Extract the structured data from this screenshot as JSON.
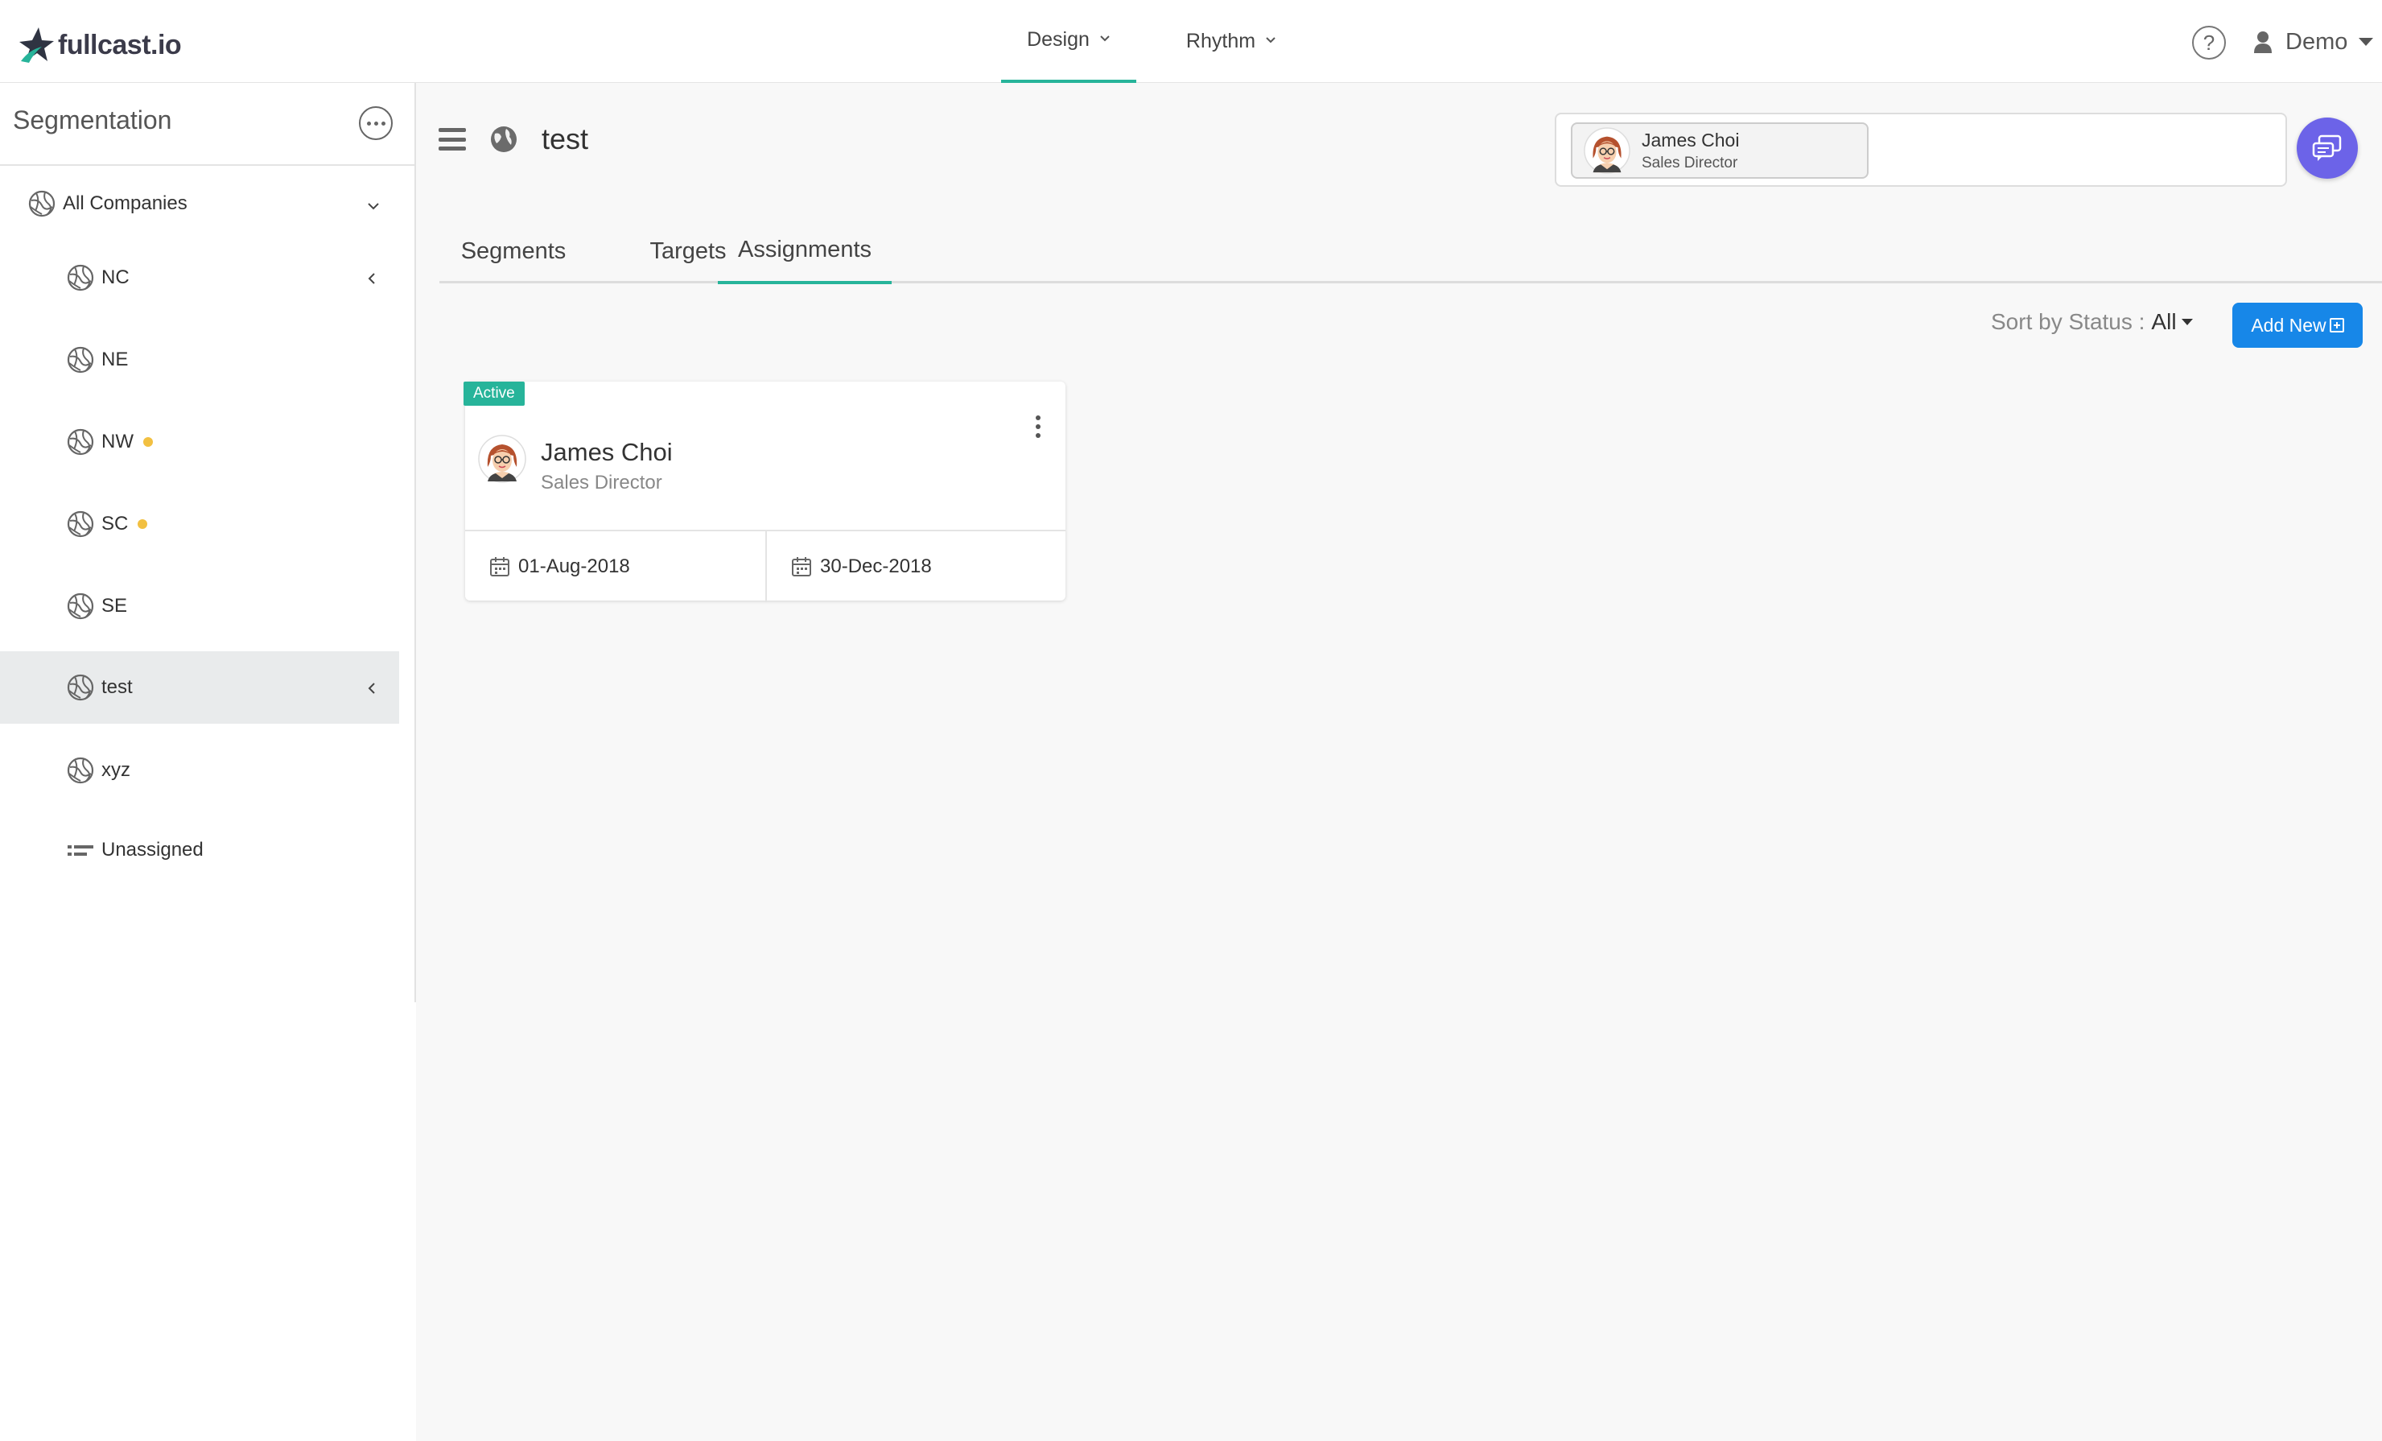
{
  "app": {
    "logo_text": "fullcast.io"
  },
  "topnav": {
    "items": [
      {
        "label": "Design",
        "active": true
      },
      {
        "label": "Rhythm",
        "active": false
      }
    ],
    "help_symbol": "?",
    "user_label": "Demo"
  },
  "sidebar": {
    "title": "Segmentation",
    "items": [
      {
        "label": "All Companies",
        "icon": "globe-icon",
        "level": 0,
        "expanded": true
      },
      {
        "label": "NC",
        "icon": "globe-icon",
        "level": 1
      },
      {
        "label": "NE",
        "icon": "globe-icon",
        "level": 1
      },
      {
        "label": "NW",
        "icon": "globe-icon",
        "level": 1,
        "status_dot": "#f2c041"
      },
      {
        "label": "SC",
        "icon": "globe-icon",
        "level": 1,
        "status_dot": "#f2c041"
      },
      {
        "label": "SE",
        "icon": "globe-icon",
        "level": 1
      },
      {
        "label": "test",
        "icon": "globe-icon",
        "level": 1,
        "selected": true
      },
      {
        "label": "xyz",
        "icon": "globe-icon",
        "level": 1
      },
      {
        "label": "Unassigned",
        "icon": "list-icon",
        "level": 1
      }
    ]
  },
  "page": {
    "title": "test",
    "owner": {
      "name": "James Choi",
      "role": "Sales Director"
    }
  },
  "tabs": [
    {
      "label": "Segments",
      "active": false
    },
    {
      "label": "Targets",
      "active": false
    },
    {
      "label": "Assignments",
      "active": true
    }
  ],
  "toolbar": {
    "sort_label": "Sort by Status :",
    "sort_value": "All",
    "add_label": "Add New"
  },
  "assignments": [
    {
      "status": "Active",
      "name": "James Choi",
      "role": "Sales Director",
      "start_date": "01-Aug-2018",
      "end_date": "30-Dec-2018"
    }
  ],
  "colors": {
    "accent": "#27b49a",
    "primary_button": "#1787e8",
    "chat_button": "#6c63e8",
    "status_dot": "#f2c041"
  }
}
